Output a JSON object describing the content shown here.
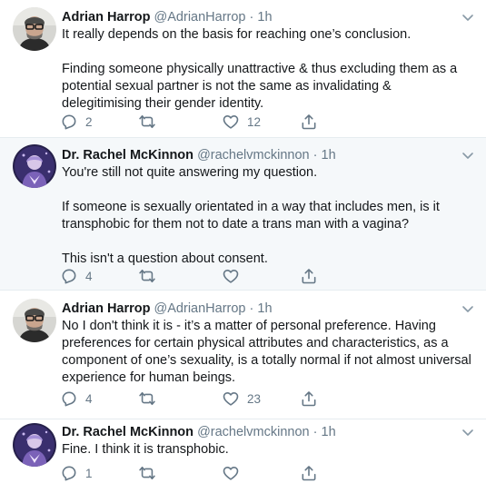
{
  "colors": {
    "text": "#14171a",
    "secondary": "#657786",
    "highlight_bg": "#f5f8fa",
    "divider": "#e6ecf0"
  },
  "tweets": [
    {
      "name": "Adrian Harrop",
      "handle": "@AdrianHarrop",
      "sep": "·",
      "time": "1h",
      "paragraphs": [
        "It really depends on the basis for reaching one’s conclusion.",
        "Finding someone physically unattractive & thus excluding them as a potential sexual partner is not the same as invalidating & delegitimising their gender identity."
      ],
      "replies": "2",
      "retweets": "",
      "likes": "12"
    },
    {
      "name": "Dr. Rachel McKinnon",
      "handle": "@rachelvmckinnon",
      "sep": "·",
      "time": "1h",
      "paragraphs": [
        "You're still not quite answering my question.",
        "If someone is sexually orientated in a way that includes men, is it transphobic for them not to date a trans man with a vagina?",
        "This isn't a question about consent."
      ],
      "replies": "4",
      "retweets": "",
      "likes": ""
    },
    {
      "name": "Adrian Harrop",
      "handle": "@AdrianHarrop",
      "sep": "·",
      "time": "1h",
      "paragraphs": [
        "No I don't think it is - it’s a matter of personal preference. Having preferences for certain physical attributes and characteristics, as a component of one’s sexuality, is a totally normal if not almost universal experience for human beings."
      ],
      "replies": "4",
      "retweets": "",
      "likes": "23"
    },
    {
      "name": "Dr. Rachel McKinnon",
      "handle": "@rachelvmckinnon",
      "sep": "·",
      "time": "1h",
      "paragraphs": [
        "Fine. I think it is transphobic."
      ],
      "replies": "1",
      "retweets": "",
      "likes": ""
    }
  ]
}
